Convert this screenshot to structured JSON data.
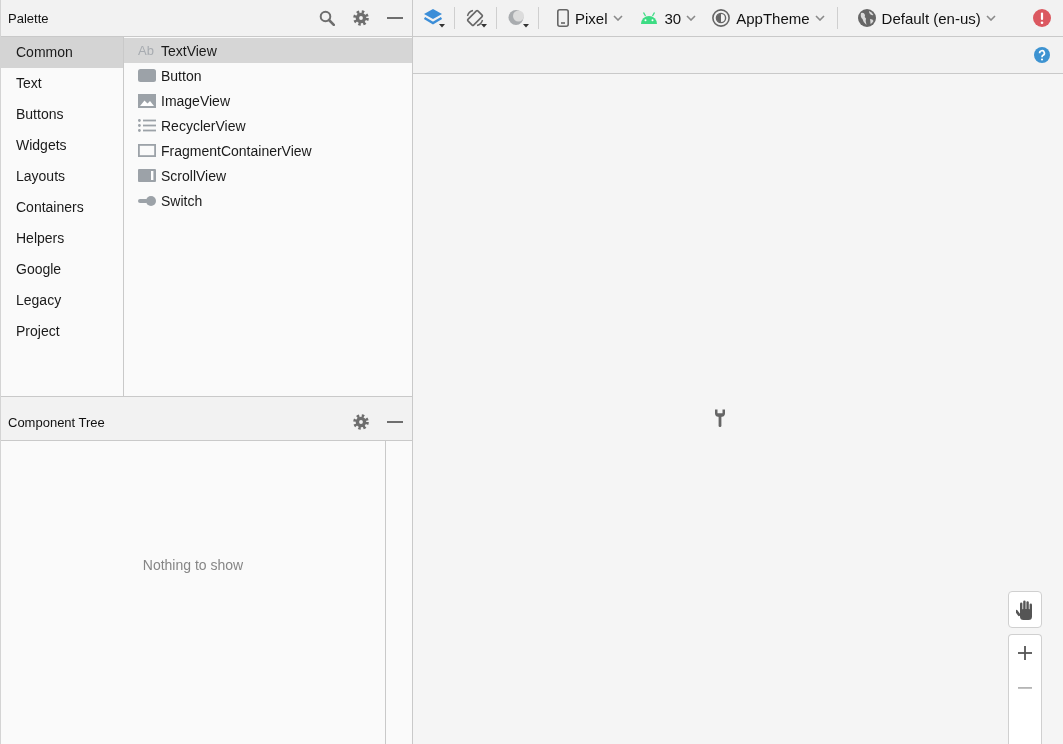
{
  "palette": {
    "title": "Palette",
    "categories": [
      {
        "label": "Common",
        "selected": true
      },
      {
        "label": "Text",
        "selected": false
      },
      {
        "label": "Buttons",
        "selected": false
      },
      {
        "label": "Widgets",
        "selected": false
      },
      {
        "label": "Layouts",
        "selected": false
      },
      {
        "label": "Containers",
        "selected": false
      },
      {
        "label": "Helpers",
        "selected": false
      },
      {
        "label": "Google",
        "selected": false
      },
      {
        "label": "Legacy",
        "selected": false
      },
      {
        "label": "Project",
        "selected": false
      }
    ],
    "widgets": [
      {
        "label": "TextView",
        "kind": "text",
        "glyph": "Ab",
        "selected": true
      },
      {
        "label": "Button",
        "kind": "button",
        "selected": false
      },
      {
        "label": "ImageView",
        "kind": "image",
        "selected": false
      },
      {
        "label": "RecyclerView",
        "kind": "list",
        "selected": false
      },
      {
        "label": "FragmentContainerView",
        "kind": "frame",
        "selected": false
      },
      {
        "label": "ScrollView",
        "kind": "scroll",
        "selected": false
      },
      {
        "label": "Switch",
        "kind": "switch",
        "selected": false
      }
    ]
  },
  "toolbar": {
    "dropdowns": [
      {
        "kind": "device",
        "label": "Pixel"
      },
      {
        "kind": "api",
        "label": "30"
      },
      {
        "kind": "theme",
        "label": "AppTheme"
      },
      {
        "kind": "locale",
        "label": "Default (en-us)"
      }
    ]
  },
  "component_tree": {
    "title": "Component Tree",
    "empty_message": "Nothing to show"
  }
}
